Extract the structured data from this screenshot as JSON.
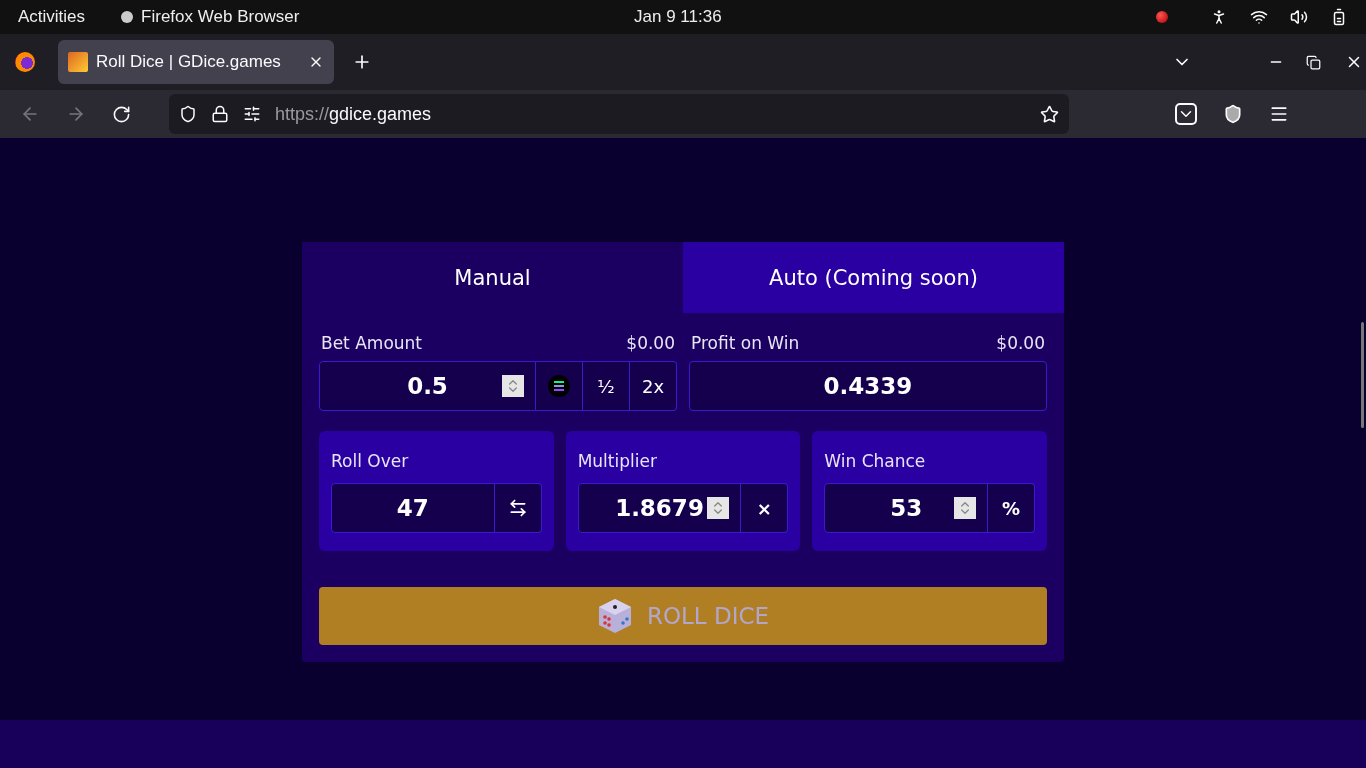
{
  "system_bar": {
    "activities": "Activities",
    "app_name": "Firefox Web Browser",
    "clock": "Jan 9  11:36"
  },
  "browser": {
    "tab_title": "Roll Dice | GDice.games",
    "url_scheme": "https://",
    "url_host": "gdice.games"
  },
  "game": {
    "tabs": [
      {
        "label": "Manual",
        "selected": true
      },
      {
        "label": "Auto (Coming soon)",
        "selected": false
      }
    ],
    "bet": {
      "label": "Bet Amount",
      "usd": "$0.00",
      "value": "0.5",
      "half": "½",
      "double": "2x"
    },
    "profit": {
      "label": "Profit on Win",
      "usd": "$0.00",
      "value": "0.4339"
    },
    "params": [
      {
        "label": "Roll Over",
        "value": "47",
        "kind": "swap",
        "spinner": false
      },
      {
        "label": "Multiplier",
        "value": "1.8679",
        "kind": "suffix",
        "suffix": "×",
        "spinner": true
      },
      {
        "label": "Win Chance",
        "value": "53",
        "kind": "suffix",
        "suffix": "%",
        "spinner": true
      }
    ],
    "roll_button": {
      "label": "ROLL DICE",
      "disabled": true
    }
  }
}
